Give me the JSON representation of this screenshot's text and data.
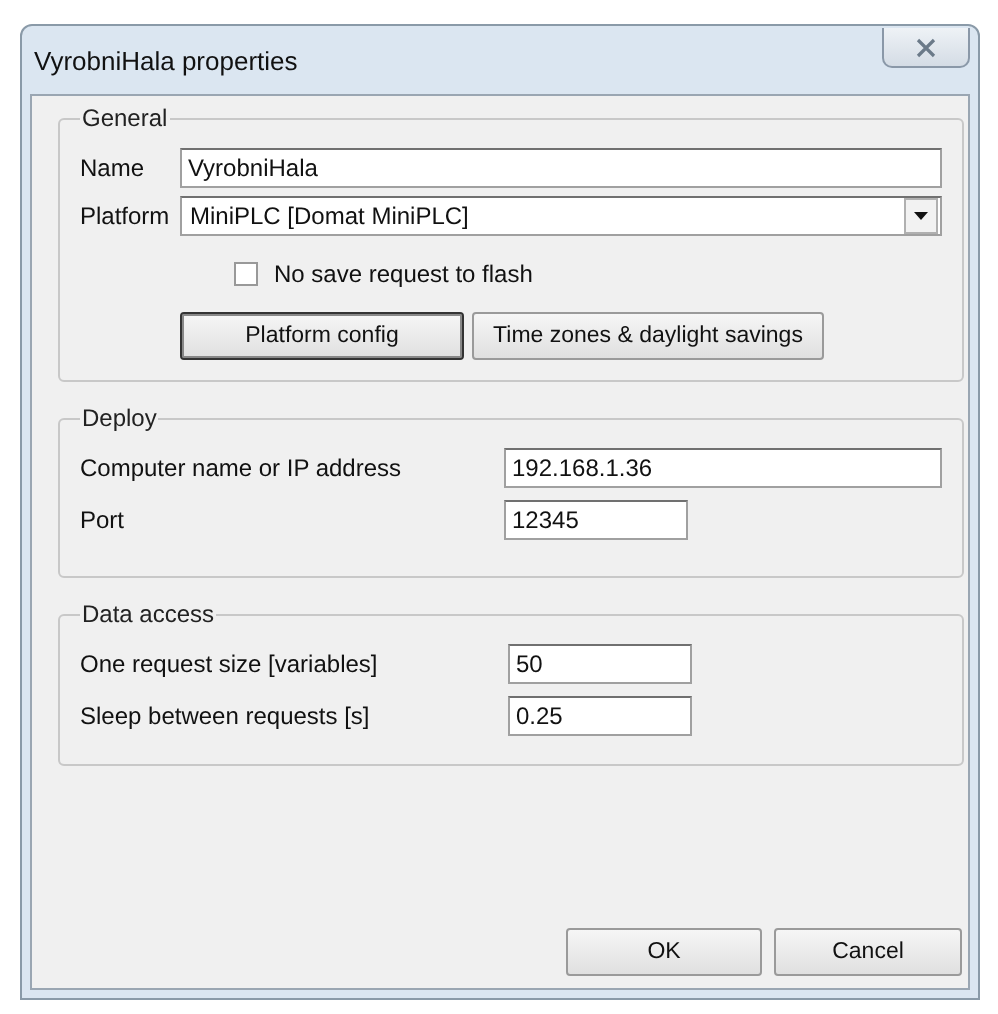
{
  "window": {
    "title": "VyrobniHala properties"
  },
  "general": {
    "legend": "General",
    "name_label": "Name",
    "name_value": "VyrobniHala",
    "platform_label": "Platform",
    "platform_value": "MiniPLC [Domat MiniPLC]",
    "checkbox": {
      "label": "No save request to flash",
      "checked": false
    },
    "buttons": [
      {
        "label": "Platform config",
        "selected": true
      },
      {
        "label": "Time zones & daylight savings",
        "selected": false
      }
    ]
  },
  "deploy": {
    "legend": "Deploy",
    "fields": [
      {
        "label": "Computer name or IP address",
        "value": "192.168.1.36",
        "kind": "wide"
      },
      {
        "label": "Port",
        "value": "12345",
        "kind": "short"
      }
    ]
  },
  "data_access": {
    "legend": "Data access",
    "fields": [
      {
        "label": "One request size [variables]",
        "value": "50",
        "kind": "short"
      },
      {
        "label": "Sleep between requests [s]",
        "value": "0.25",
        "kind": "short"
      }
    ]
  },
  "buttons": [
    "OK",
    "Cancel"
  ]
}
